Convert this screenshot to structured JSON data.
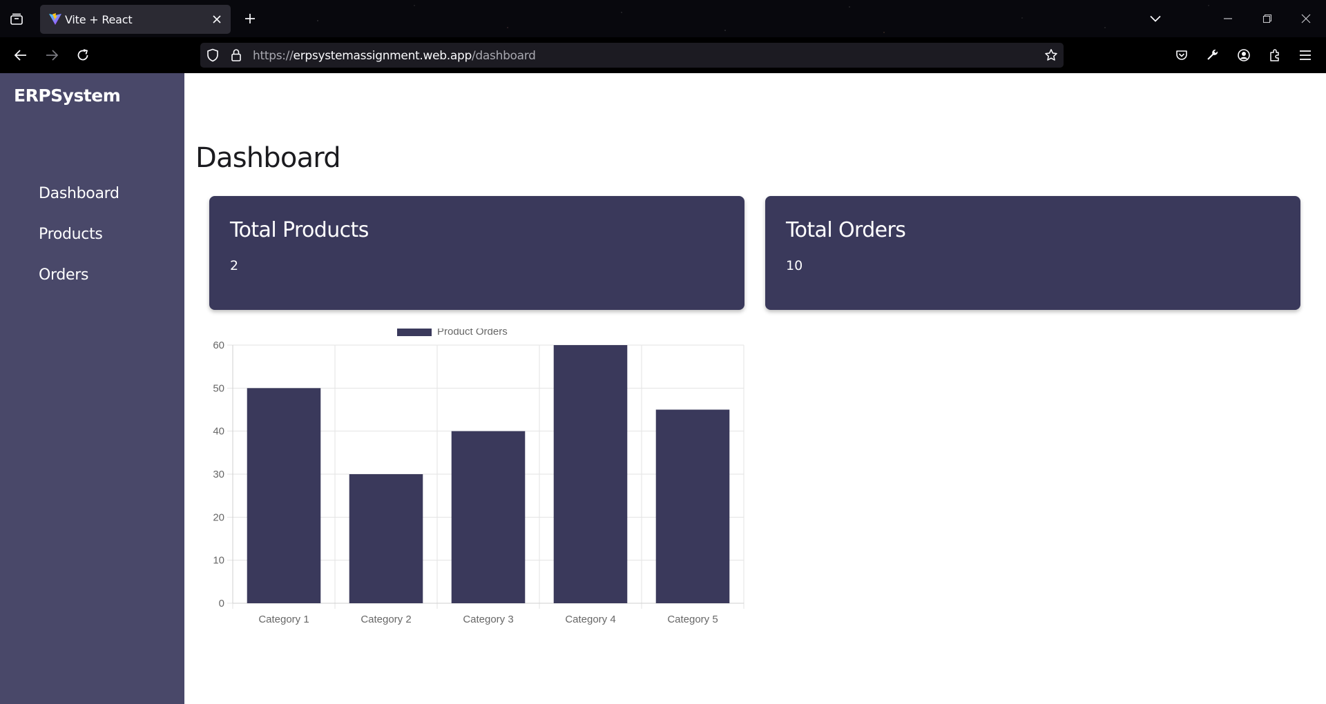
{
  "browser": {
    "tab_title": "Vite + React",
    "url_scheme": "https://",
    "url_host": "erpsystemassignment.web.app",
    "url_path": "/dashboard"
  },
  "sidebar": {
    "brand": "ERPSystem",
    "items": [
      {
        "label": "Dashboard"
      },
      {
        "label": "Products"
      },
      {
        "label": "Orders"
      }
    ],
    "bg_color": "#494869"
  },
  "main": {
    "title": "Dashboard",
    "cards": [
      {
        "title": "Total Products",
        "value": "2"
      },
      {
        "title": "Total Orders",
        "value": "10"
      }
    ],
    "card_color": "#3a395b"
  },
  "chart_data": {
    "type": "bar",
    "categories": [
      "Category 1",
      "Category 2",
      "Category 3",
      "Category 4",
      "Category 5"
    ],
    "series": [
      {
        "name": "Product Orders",
        "values": [
          50,
          30,
          40,
          60,
          45
        ],
        "color": "#3a395b"
      }
    ],
    "ylim": [
      0,
      60
    ],
    "yticks": [
      0,
      10,
      20,
      30,
      40,
      50,
      60
    ],
    "grid": true,
    "legend": "top-center",
    "title": "",
    "xlabel": "",
    "ylabel": ""
  }
}
